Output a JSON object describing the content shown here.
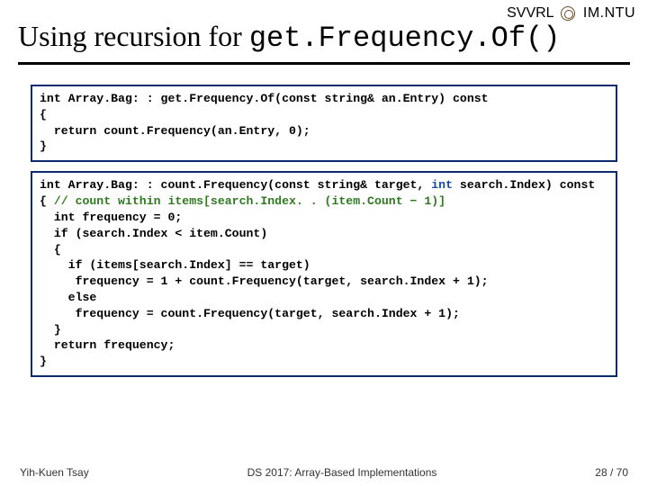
{
  "header": {
    "svvrl": "SVVRL",
    "at": "@",
    "ntu": "IM.NTU"
  },
  "title": {
    "prefix": "Using recursion for ",
    "mono": "get.Frequency.Of()"
  },
  "code": {
    "box1": "int Array.Bag: : get.Frequency.Of(const string& an.Entry) const\n{\n  return count.Frequency(an.Entry, 0);\n}",
    "box2": {
      "line1_pre": "int Array.Bag: : count.Frequency(const string& target, ",
      "line1_kw": "int",
      "line1_post": " search.Index) const",
      "line2_open": "{ ",
      "line2_comment": "// count within items[search.Index. . (item.Count − 1)]",
      "lines_rest": "  int frequency = 0;\n  if (search.Index < item.Count)\n  {\n    if (items[search.Index] == target)\n     frequency = 1 + count.Frequency(target, search.Index + 1);\n    else\n     frequency = count.Frequency(target, search.Index + 1);\n  }\n  return frequency;\n}"
    }
  },
  "footer": {
    "author": "Yih-Kuen Tsay",
    "course": "DS 2017: Array-Based Implementations",
    "page": "28 / 70"
  }
}
